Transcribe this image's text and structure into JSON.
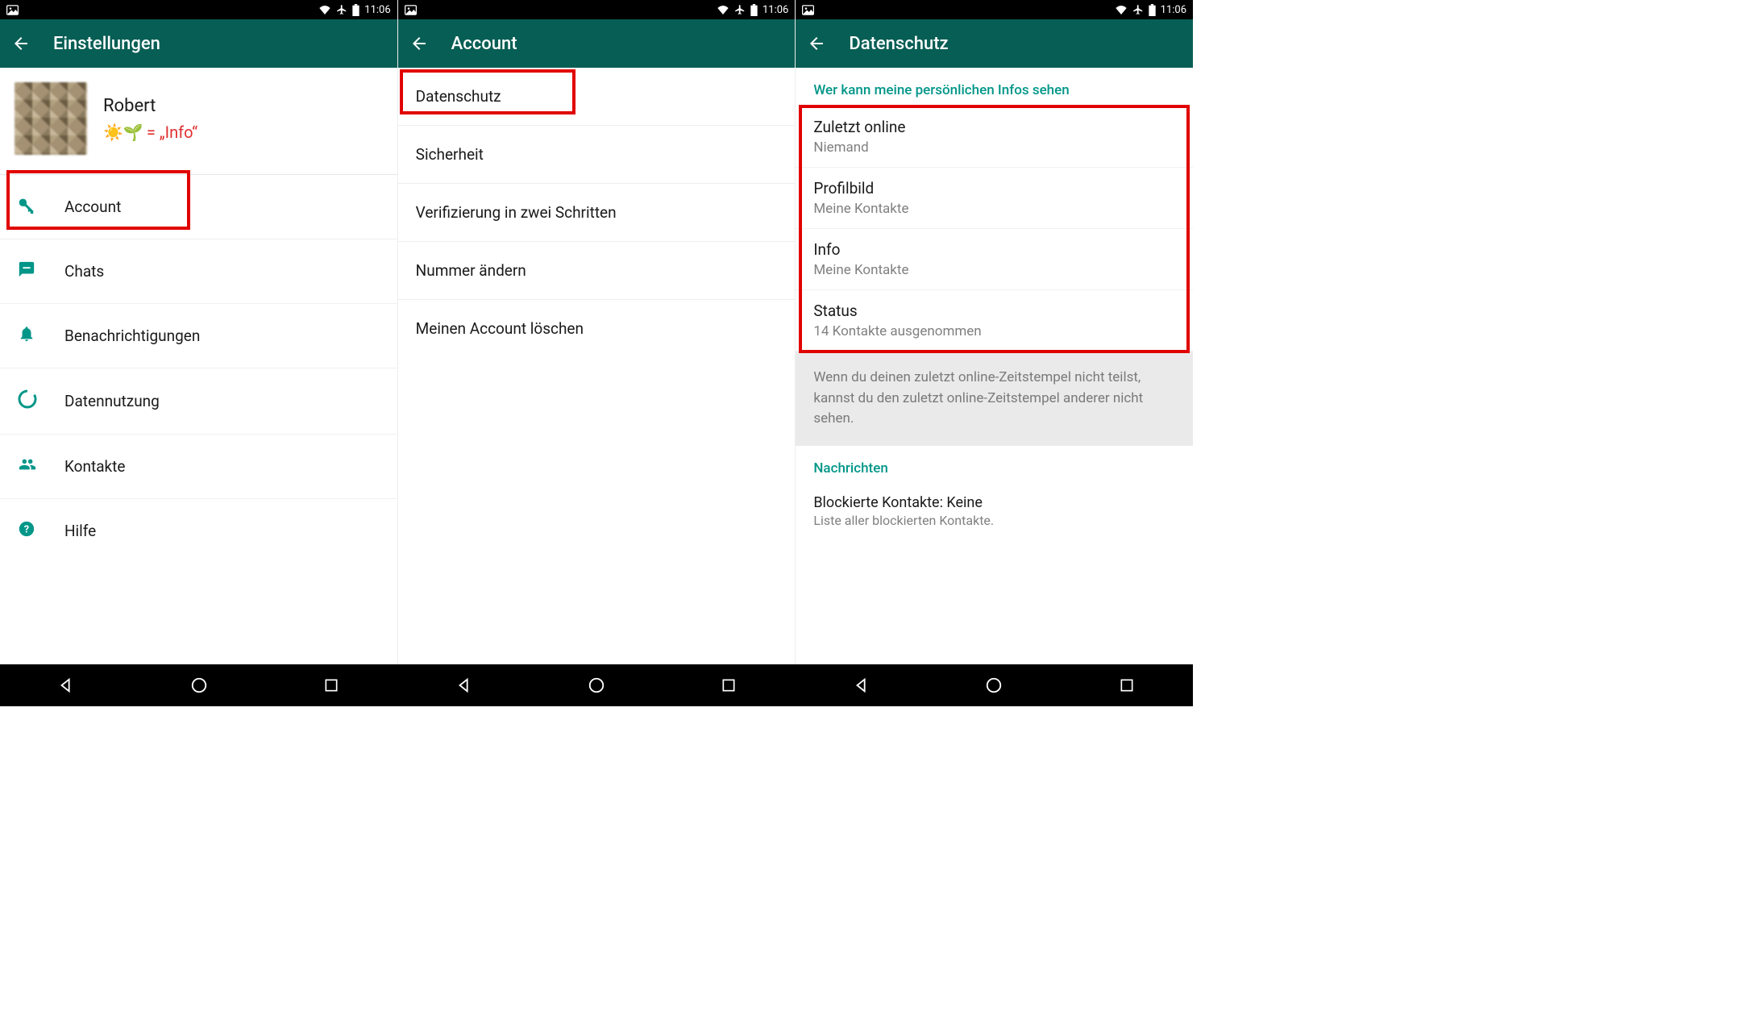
{
  "status": {
    "time": "11:06"
  },
  "screens": [
    {
      "title": "Einstellungen",
      "profile": {
        "name": "Robert",
        "status_prefix": "☀️🌱",
        "status_text": " = „Info“"
      },
      "items": [
        {
          "label": "Account"
        },
        {
          "label": "Chats"
        },
        {
          "label": "Benachrichtigungen"
        },
        {
          "label": "Datennutzung"
        },
        {
          "label": "Kontakte"
        },
        {
          "label": "Hilfe"
        }
      ]
    },
    {
      "title": "Account",
      "items": [
        {
          "label": "Datenschutz"
        },
        {
          "label": "Sicherheit"
        },
        {
          "label": "Verifizierung in zwei Schritten"
        },
        {
          "label": "Nummer ändern"
        },
        {
          "label": "Meinen Account löschen"
        }
      ]
    },
    {
      "title": "Datenschutz",
      "section1_header": "Wer kann meine persönlichen Infos sehen",
      "items": [
        {
          "title": "Zuletzt online",
          "sub": "Niemand"
        },
        {
          "title": "Profilbild",
          "sub": "Meine Kontakte"
        },
        {
          "title": "Info",
          "sub": "Meine Kontakte"
        },
        {
          "title": "Status",
          "sub": "14 Kontakte ausgenommen"
        }
      ],
      "info_text": "Wenn du deinen zuletzt online-Zeitstempel nicht teilst, kannst du den zuletzt online-Zeitstempel anderer nicht sehen.",
      "section2_header": "Nachrichten",
      "blocked_title": "Blockierte Kontakte: Keine",
      "blocked_sub": "Liste aller blockierten Kontakte."
    }
  ]
}
